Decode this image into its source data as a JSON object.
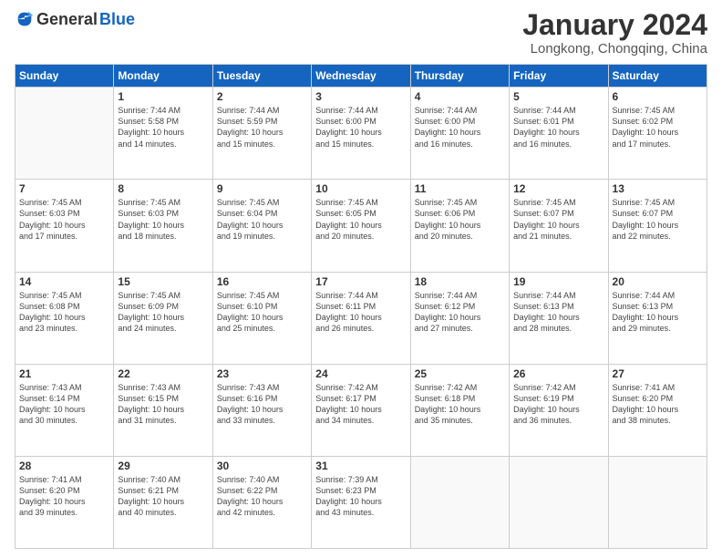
{
  "logo": {
    "general": "General",
    "blue": "Blue"
  },
  "header": {
    "month": "January 2024",
    "location": "Longkong, Chongqing, China"
  },
  "weekdays": [
    "Sunday",
    "Monday",
    "Tuesday",
    "Wednesday",
    "Thursday",
    "Friday",
    "Saturday"
  ],
  "weeks": [
    [
      {
        "day": "",
        "info": ""
      },
      {
        "day": "1",
        "info": "Sunrise: 7:44 AM\nSunset: 5:58 PM\nDaylight: 10 hours\nand 14 minutes."
      },
      {
        "day": "2",
        "info": "Sunrise: 7:44 AM\nSunset: 5:59 PM\nDaylight: 10 hours\nand 15 minutes."
      },
      {
        "day": "3",
        "info": "Sunrise: 7:44 AM\nSunset: 6:00 PM\nDaylight: 10 hours\nand 15 minutes."
      },
      {
        "day": "4",
        "info": "Sunrise: 7:44 AM\nSunset: 6:00 PM\nDaylight: 10 hours\nand 16 minutes."
      },
      {
        "day": "5",
        "info": "Sunrise: 7:44 AM\nSunset: 6:01 PM\nDaylight: 10 hours\nand 16 minutes."
      },
      {
        "day": "6",
        "info": "Sunrise: 7:45 AM\nSunset: 6:02 PM\nDaylight: 10 hours\nand 17 minutes."
      }
    ],
    [
      {
        "day": "7",
        "info": "Sunrise: 7:45 AM\nSunset: 6:03 PM\nDaylight: 10 hours\nand 17 minutes."
      },
      {
        "day": "8",
        "info": "Sunrise: 7:45 AM\nSunset: 6:03 PM\nDaylight: 10 hours\nand 18 minutes."
      },
      {
        "day": "9",
        "info": "Sunrise: 7:45 AM\nSunset: 6:04 PM\nDaylight: 10 hours\nand 19 minutes."
      },
      {
        "day": "10",
        "info": "Sunrise: 7:45 AM\nSunset: 6:05 PM\nDaylight: 10 hours\nand 20 minutes."
      },
      {
        "day": "11",
        "info": "Sunrise: 7:45 AM\nSunset: 6:06 PM\nDaylight: 10 hours\nand 20 minutes."
      },
      {
        "day": "12",
        "info": "Sunrise: 7:45 AM\nSunset: 6:07 PM\nDaylight: 10 hours\nand 21 minutes."
      },
      {
        "day": "13",
        "info": "Sunrise: 7:45 AM\nSunset: 6:07 PM\nDaylight: 10 hours\nand 22 minutes."
      }
    ],
    [
      {
        "day": "14",
        "info": "Sunrise: 7:45 AM\nSunset: 6:08 PM\nDaylight: 10 hours\nand 23 minutes."
      },
      {
        "day": "15",
        "info": "Sunrise: 7:45 AM\nSunset: 6:09 PM\nDaylight: 10 hours\nand 24 minutes."
      },
      {
        "day": "16",
        "info": "Sunrise: 7:45 AM\nSunset: 6:10 PM\nDaylight: 10 hours\nand 25 minutes."
      },
      {
        "day": "17",
        "info": "Sunrise: 7:44 AM\nSunset: 6:11 PM\nDaylight: 10 hours\nand 26 minutes."
      },
      {
        "day": "18",
        "info": "Sunrise: 7:44 AM\nSunset: 6:12 PM\nDaylight: 10 hours\nand 27 minutes."
      },
      {
        "day": "19",
        "info": "Sunrise: 7:44 AM\nSunset: 6:13 PM\nDaylight: 10 hours\nand 28 minutes."
      },
      {
        "day": "20",
        "info": "Sunrise: 7:44 AM\nSunset: 6:13 PM\nDaylight: 10 hours\nand 29 minutes."
      }
    ],
    [
      {
        "day": "21",
        "info": "Sunrise: 7:43 AM\nSunset: 6:14 PM\nDaylight: 10 hours\nand 30 minutes."
      },
      {
        "day": "22",
        "info": "Sunrise: 7:43 AM\nSunset: 6:15 PM\nDaylight: 10 hours\nand 31 minutes."
      },
      {
        "day": "23",
        "info": "Sunrise: 7:43 AM\nSunset: 6:16 PM\nDaylight: 10 hours\nand 33 minutes."
      },
      {
        "day": "24",
        "info": "Sunrise: 7:42 AM\nSunset: 6:17 PM\nDaylight: 10 hours\nand 34 minutes."
      },
      {
        "day": "25",
        "info": "Sunrise: 7:42 AM\nSunset: 6:18 PM\nDaylight: 10 hours\nand 35 minutes."
      },
      {
        "day": "26",
        "info": "Sunrise: 7:42 AM\nSunset: 6:19 PM\nDaylight: 10 hours\nand 36 minutes."
      },
      {
        "day": "27",
        "info": "Sunrise: 7:41 AM\nSunset: 6:20 PM\nDaylight: 10 hours\nand 38 minutes."
      }
    ],
    [
      {
        "day": "28",
        "info": "Sunrise: 7:41 AM\nSunset: 6:20 PM\nDaylight: 10 hours\nand 39 minutes."
      },
      {
        "day": "29",
        "info": "Sunrise: 7:40 AM\nSunset: 6:21 PM\nDaylight: 10 hours\nand 40 minutes."
      },
      {
        "day": "30",
        "info": "Sunrise: 7:40 AM\nSunset: 6:22 PM\nDaylight: 10 hours\nand 42 minutes."
      },
      {
        "day": "31",
        "info": "Sunrise: 7:39 AM\nSunset: 6:23 PM\nDaylight: 10 hours\nand 43 minutes."
      },
      {
        "day": "",
        "info": ""
      },
      {
        "day": "",
        "info": ""
      },
      {
        "day": "",
        "info": ""
      }
    ]
  ]
}
